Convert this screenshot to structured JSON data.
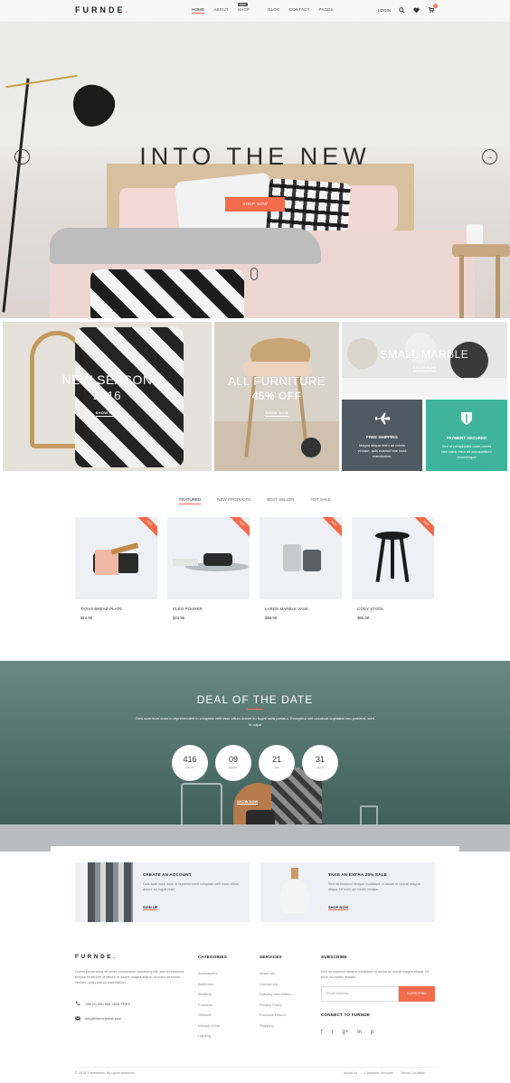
{
  "header": {
    "logo": "FURNDE",
    "logo_dot": ".",
    "nav": [
      "HOME",
      "ABOUT",
      "SHOP",
      "BLOG",
      "CONTACT",
      "PAGES"
    ],
    "nav_badge": "NEW",
    "login": "LOGIN",
    "cart_count": "0"
  },
  "hero": {
    "title": "INTO THE NEW",
    "button": "SHOP NOW"
  },
  "banners": [
    {
      "title": "NEW SEASON",
      "subtitle": "2016",
      "link": "SHOW NOW"
    },
    {
      "title": "ALL FURNITURE",
      "subtitle": "45% OFF",
      "link": "SHOW NOW"
    },
    {
      "title": "SMALL MARBLE",
      "subtitle": "",
      "link": "SHOW NOW"
    }
  ],
  "info_boxes": [
    {
      "icon": "plane-icon",
      "title": "FREE SHIPPING",
      "text": "Magna aliqua enim ad minim veniam, quis nostrud exe incid exercitation.",
      "color": "#4f5a62"
    },
    {
      "icon": "shield-icon",
      "title": "PAYMENT SECURED",
      "text": "Sed ut perspiciatis unde omnis iste natus error sit accusantium doloremque",
      "color": "#3fb49a"
    }
  ],
  "tabs": [
    "FEATURED",
    "NEW PRODUCTS",
    "BEST SELLER",
    "HOT SALE"
  ],
  "products": [
    {
      "name": "TAPAS BREAD PLATE",
      "price": "$14.95",
      "badge": "HOT"
    },
    {
      "name": "CLEO POURER",
      "price": "$24.95",
      "badge": "HOT"
    },
    {
      "name": "LARGE MARBLE VASE",
      "price": "$99.95",
      "badge": "HOT"
    },
    {
      "name": "CODY STOOL",
      "price": "$85.99",
      "badge": "HOT"
    }
  ],
  "deal": {
    "title": "DEAL OF THE DATE",
    "text": "Duis aute irure dolor in reprehenderit in voluptate velit esse cillum dolore eu fugiat nulla pariatur. Excepteur sint occaecat cupidatat non proident, sunt in culpa",
    "countdown": [
      {
        "value": "416",
        "label": "DAYS"
      },
      {
        "value": "09",
        "label": "HOURS"
      },
      {
        "value": "21",
        "label": "MIN"
      },
      {
        "value": "31",
        "label": "SECS"
      }
    ],
    "button": "SHOW NOW"
  },
  "promos": [
    {
      "title": "CREATE AN ACCOUNT",
      "text": "Duis aute irure dolor in reprehenderit voluptate velit esse cillum dolore eu fugiat nulla",
      "link": "SIGN UP"
    },
    {
      "title": "TAKE AN EXTRA 25% SALE",
      "text": "Sed do eiusmod tempor incididunt ut labore et dolore magna aliqua. Ut enim ad minim veniam",
      "link": "SHOP NOW"
    }
  ],
  "footer": {
    "logo": "FURNDE.",
    "about": "Lorem ipsum dolor sit amet, consectetur adipiscing elit, sed do eiusmod tempor incididunt ut labore et dolore magna aliqua. Ut enim ad minim veniam, quis nostrud exercitation",
    "phone": "+84 (0) 400 956 7826 FREE",
    "email": "info@themeforest.com",
    "categories_title": "CATEGORIES",
    "categories": [
      "Accessories",
      "Bathroom",
      "Bedding",
      "Furniture",
      "Glasses",
      "Kitchen & Bar",
      "Lighting"
    ],
    "services_title": "SERVICES",
    "services": [
      "About Us",
      "Contact Us",
      "Delivery Information",
      "Privacy Policy",
      "Products Return",
      "Shipping"
    ],
    "subscribe_title": "SUBSCRIBE",
    "subscribe_text": "Sed do eiusmod tempor incididunt ut labore et dolore magna aliqua. Ut enim ad minim veniam",
    "email_placeholder": "Email Address",
    "subscribe_button": "SUBSCRIBE",
    "connect_title": "CONNECT TO FURNDE",
    "social": [
      "f",
      "t",
      "g+",
      "in",
      "p"
    ],
    "copyright": "© 2016 Themeallen. All rights reserved",
    "links": [
      "About us",
      "Customer Services",
      "Terms Condition"
    ]
  },
  "colors": {
    "accent": "#f26b4b",
    "dark_box": "#4f5a62",
    "green_box": "#3fb49a"
  }
}
